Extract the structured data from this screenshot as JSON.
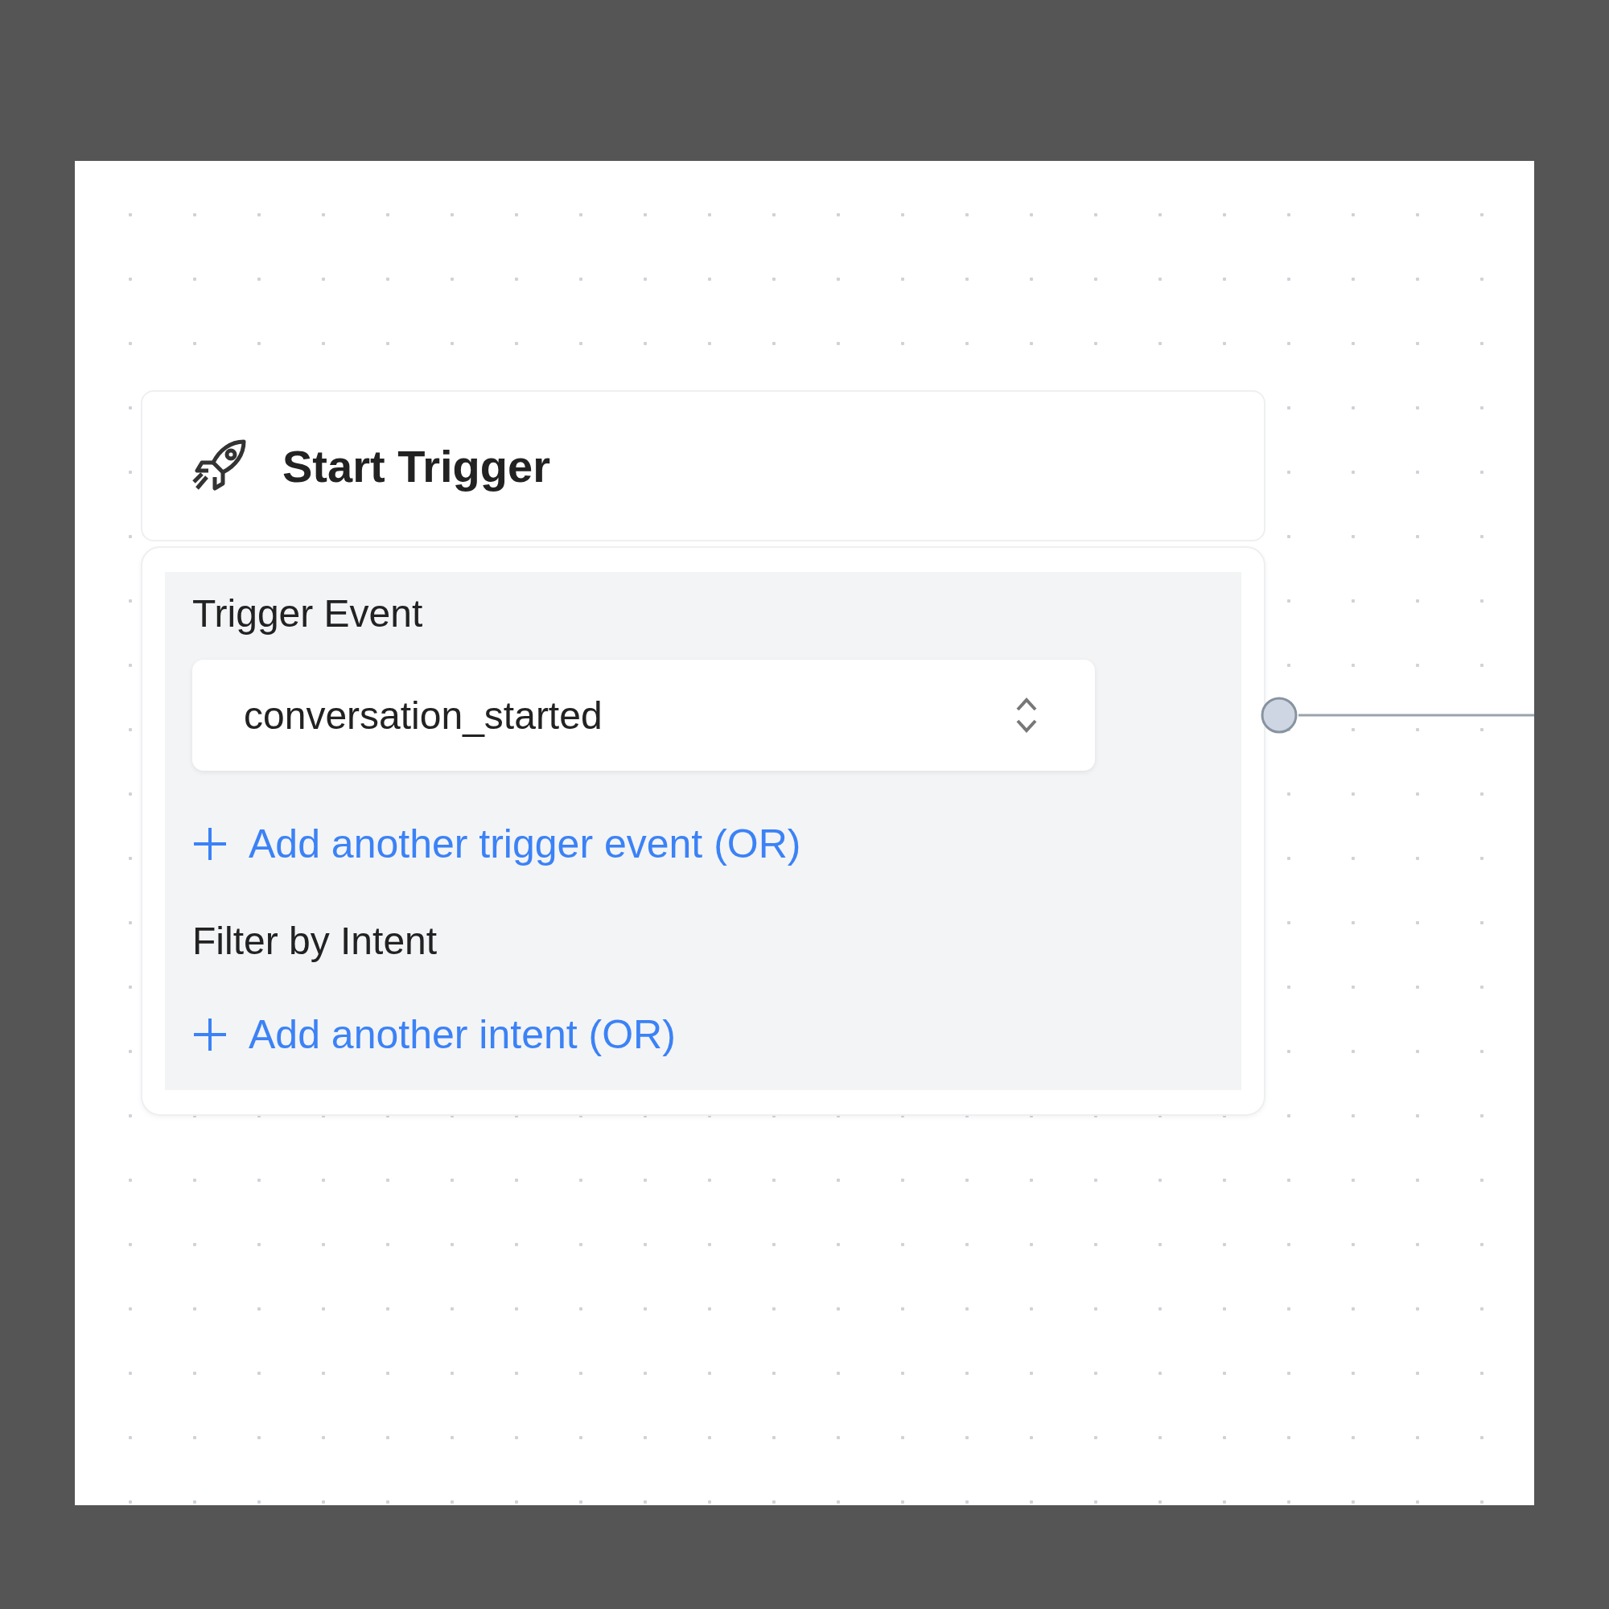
{
  "node": {
    "title": "Start Trigger",
    "trigger_event": {
      "label": "Trigger Event",
      "value": "conversation_started",
      "add_link": "Add another trigger event (OR)"
    },
    "intent_filter": {
      "label": "Filter by Intent",
      "add_link": "Add another intent (OR)"
    }
  }
}
